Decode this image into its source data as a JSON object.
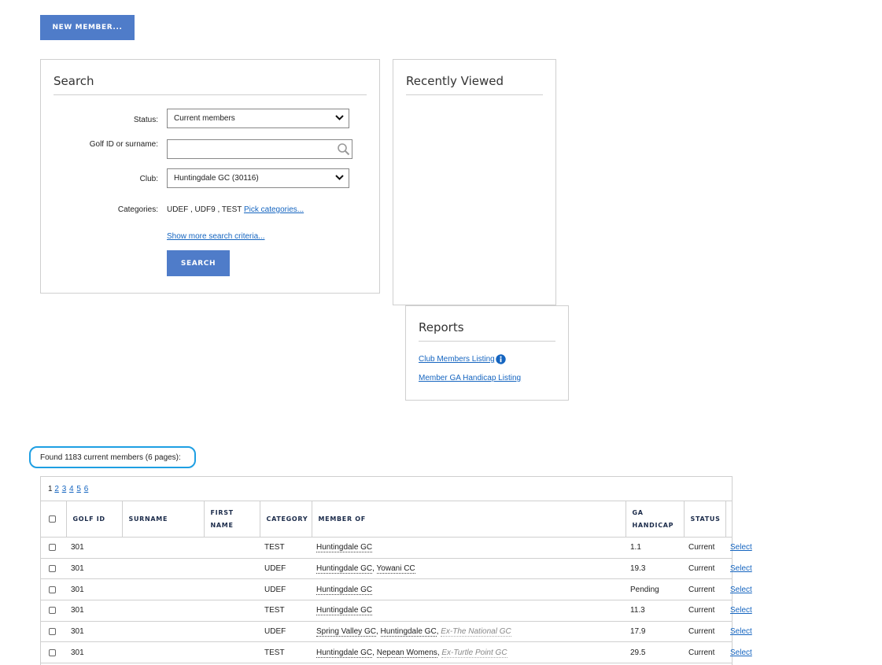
{
  "new_member_button": "NEW MEMBER...",
  "search": {
    "title": "Search",
    "status_label": "Status:",
    "status_value": "Current members",
    "golf_id_label": "Golf ID or surname:",
    "golf_id_value": "",
    "club_label": "Club:",
    "club_value": "Huntingdale GC (30116)",
    "categories_label": "Categories:",
    "categories_value": "UDEF , UDF9 , TEST",
    "pick_categories_link": "Pick categories...",
    "show_more_link": "Show more search criteria...",
    "search_button": "SEARCH"
  },
  "recently_viewed": {
    "title": "Recently Viewed"
  },
  "reports": {
    "title": "Reports",
    "club_members_listing": "Club Members Listing",
    "member_ga_handicap_listing": "Member GA Handicap Listing"
  },
  "results_summary": "Found 1183 current members (6 pages):",
  "pager": {
    "current": "1",
    "pages": [
      "2",
      "3",
      "4",
      "5",
      "6"
    ]
  },
  "table": {
    "headers": {
      "golf_id": "GOLF ID",
      "surname": "SURNAME",
      "first_name_1": "FIRST",
      "first_name_2": "NAME",
      "category": "CATEGORY",
      "member_of": "MEMBER OF",
      "ga_handicap_1": "GA",
      "ga_handicap_2": "HANDICAP",
      "status": "STATUS"
    },
    "rows": [
      {
        "golf_id": "301",
        "surname": "",
        "first_name": "",
        "category": "TEST",
        "clubs": [
          "Huntingdale GC"
        ],
        "ex_club": "",
        "handicap": "1.1",
        "status": "Current",
        "action": "Select"
      },
      {
        "golf_id": "301",
        "surname": "",
        "first_name": "",
        "category": "UDEF",
        "clubs": [
          "Huntingdale GC",
          "Yowani CC"
        ],
        "ex_club": "",
        "handicap": "19.3",
        "status": "Current",
        "action": "Select"
      },
      {
        "golf_id": "301",
        "surname": "",
        "first_name": "",
        "category": "UDEF",
        "clubs": [
          "Huntingdale GC"
        ],
        "ex_club": "",
        "handicap": "Pending",
        "status": "Current",
        "action": "Select"
      },
      {
        "golf_id": "301",
        "surname": "",
        "first_name": "",
        "category": "TEST",
        "clubs": [
          "Huntingdale GC"
        ],
        "ex_club": "",
        "handicap": "11.3",
        "status": "Current",
        "action": "Select"
      },
      {
        "golf_id": "301",
        "surname": "",
        "first_name": "",
        "category": "UDEF",
        "clubs": [
          "Spring Valley GC",
          "Huntingdale GC"
        ],
        "ex_club": "Ex-The National GC",
        "handicap": "17.9",
        "status": "Current",
        "action": "Select"
      },
      {
        "golf_id": "301",
        "surname": "",
        "first_name": "",
        "category": "TEST",
        "clubs": [
          "Huntingdale GC",
          "Nepean Womens"
        ],
        "ex_club": "Ex-Turtle Point GC",
        "handicap": "29.5",
        "status": "Current",
        "action": "Select"
      }
    ]
  },
  "colors": {
    "primary_button": "#4f7cc9",
    "link": "#1565c0",
    "highlight_outline": "#1e9fe3",
    "info_icon": "#1565c0"
  }
}
